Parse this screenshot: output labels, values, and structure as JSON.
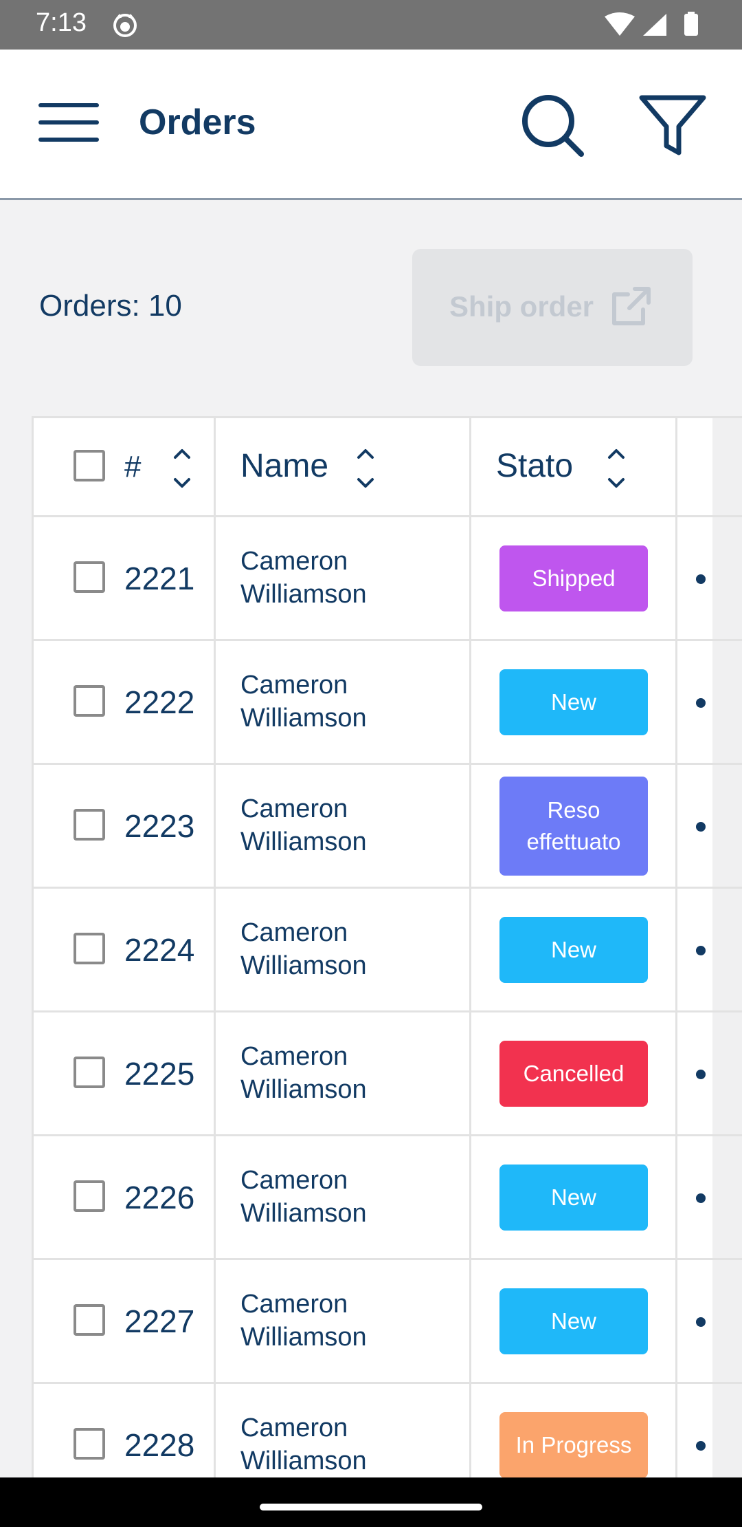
{
  "status_bar": {
    "time": "7:13"
  },
  "app_bar": {
    "title": "Orders"
  },
  "summary": {
    "orders_count": "Orders: 10",
    "ship_button": "Ship order"
  },
  "table": {
    "headers": {
      "id": "#",
      "name": "Name",
      "status": "Stato"
    },
    "rows": [
      {
        "id": "2221",
        "name": "Cameron Williamson",
        "status": "Shipped",
        "status_color": "#bf56ee"
      },
      {
        "id": "2222",
        "name": "Cameron Williamson",
        "status": "New",
        "status_color": "#1fb8f9"
      },
      {
        "id": "2223",
        "name": "Cameron Williamson",
        "status": "Reso effettuato",
        "status_color": "#6d7bf7"
      },
      {
        "id": "2224",
        "name": "Cameron Williamson",
        "status": "New",
        "status_color": "#1fb8f9"
      },
      {
        "id": "2225",
        "name": "Cameron Williamson",
        "status": "Cancelled",
        "status_color": "#f2324f"
      },
      {
        "id": "2226",
        "name": "Cameron Williamson",
        "status": "New",
        "status_color": "#1fb8f9"
      },
      {
        "id": "2227",
        "name": "Cameron Williamson",
        "status": "New",
        "status_color": "#1fb8f9"
      },
      {
        "id": "2228",
        "name": "Cameron Williamson",
        "status": "In Progress",
        "status_color": "#fba46c"
      }
    ]
  },
  "colors": {
    "primary_text": "#123a63",
    "status_bar": "#737373",
    "disabled_button_bg": "#e3e4e6",
    "disabled_button_text": "#c3c9d1"
  },
  "icons": {
    "menu": "hamburger-menu-icon",
    "search": "search-icon",
    "filter": "filter-icon",
    "external_link": "external-link-icon",
    "sort": "sort-icon",
    "more": "more-horizontal-icon"
  }
}
